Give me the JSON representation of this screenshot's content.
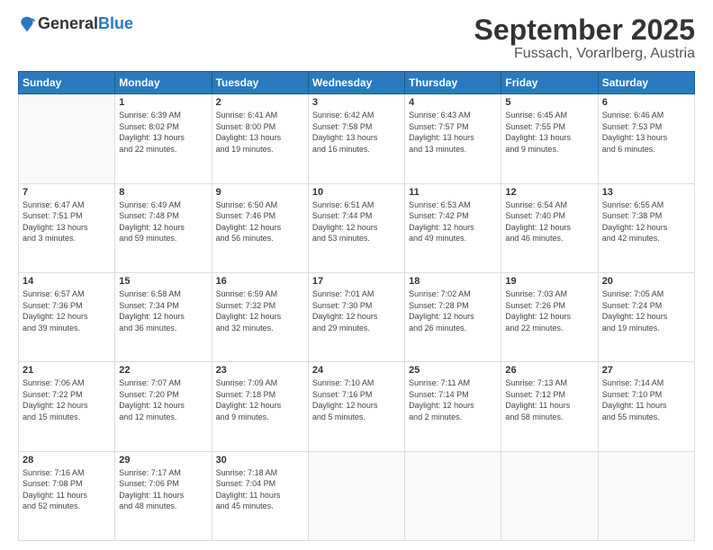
{
  "logo": {
    "general": "General",
    "blue": "Blue"
  },
  "title": "September 2025",
  "location": "Fussach, Vorarlberg, Austria",
  "days_of_week": [
    "Sunday",
    "Monday",
    "Tuesday",
    "Wednesday",
    "Thursday",
    "Friday",
    "Saturday"
  ],
  "weeks": [
    [
      {
        "day": "",
        "info": ""
      },
      {
        "day": "1",
        "info": "Sunrise: 6:39 AM\nSunset: 8:02 PM\nDaylight: 13 hours\nand 22 minutes."
      },
      {
        "day": "2",
        "info": "Sunrise: 6:41 AM\nSunset: 8:00 PM\nDaylight: 13 hours\nand 19 minutes."
      },
      {
        "day": "3",
        "info": "Sunrise: 6:42 AM\nSunset: 7:58 PM\nDaylight: 13 hours\nand 16 minutes."
      },
      {
        "day": "4",
        "info": "Sunrise: 6:43 AM\nSunset: 7:57 PM\nDaylight: 13 hours\nand 13 minutes."
      },
      {
        "day": "5",
        "info": "Sunrise: 6:45 AM\nSunset: 7:55 PM\nDaylight: 13 hours\nand 9 minutes."
      },
      {
        "day": "6",
        "info": "Sunrise: 6:46 AM\nSunset: 7:53 PM\nDaylight: 13 hours\nand 6 minutes."
      }
    ],
    [
      {
        "day": "7",
        "info": "Sunrise: 6:47 AM\nSunset: 7:51 PM\nDaylight: 13 hours\nand 3 minutes."
      },
      {
        "day": "8",
        "info": "Sunrise: 6:49 AM\nSunset: 7:48 PM\nDaylight: 12 hours\nand 59 minutes."
      },
      {
        "day": "9",
        "info": "Sunrise: 6:50 AM\nSunset: 7:46 PM\nDaylight: 12 hours\nand 56 minutes."
      },
      {
        "day": "10",
        "info": "Sunrise: 6:51 AM\nSunset: 7:44 PM\nDaylight: 12 hours\nand 53 minutes."
      },
      {
        "day": "11",
        "info": "Sunrise: 6:53 AM\nSunset: 7:42 PM\nDaylight: 12 hours\nand 49 minutes."
      },
      {
        "day": "12",
        "info": "Sunrise: 6:54 AM\nSunset: 7:40 PM\nDaylight: 12 hours\nand 46 minutes."
      },
      {
        "day": "13",
        "info": "Sunrise: 6:55 AM\nSunset: 7:38 PM\nDaylight: 12 hours\nand 42 minutes."
      }
    ],
    [
      {
        "day": "14",
        "info": "Sunrise: 6:57 AM\nSunset: 7:36 PM\nDaylight: 12 hours\nand 39 minutes."
      },
      {
        "day": "15",
        "info": "Sunrise: 6:58 AM\nSunset: 7:34 PM\nDaylight: 12 hours\nand 36 minutes."
      },
      {
        "day": "16",
        "info": "Sunrise: 6:59 AM\nSunset: 7:32 PM\nDaylight: 12 hours\nand 32 minutes."
      },
      {
        "day": "17",
        "info": "Sunrise: 7:01 AM\nSunset: 7:30 PM\nDaylight: 12 hours\nand 29 minutes."
      },
      {
        "day": "18",
        "info": "Sunrise: 7:02 AM\nSunset: 7:28 PM\nDaylight: 12 hours\nand 26 minutes."
      },
      {
        "day": "19",
        "info": "Sunrise: 7:03 AM\nSunset: 7:26 PM\nDaylight: 12 hours\nand 22 minutes."
      },
      {
        "day": "20",
        "info": "Sunrise: 7:05 AM\nSunset: 7:24 PM\nDaylight: 12 hours\nand 19 minutes."
      }
    ],
    [
      {
        "day": "21",
        "info": "Sunrise: 7:06 AM\nSunset: 7:22 PM\nDaylight: 12 hours\nand 15 minutes."
      },
      {
        "day": "22",
        "info": "Sunrise: 7:07 AM\nSunset: 7:20 PM\nDaylight: 12 hours\nand 12 minutes."
      },
      {
        "day": "23",
        "info": "Sunrise: 7:09 AM\nSunset: 7:18 PM\nDaylight: 12 hours\nand 9 minutes."
      },
      {
        "day": "24",
        "info": "Sunrise: 7:10 AM\nSunset: 7:16 PM\nDaylight: 12 hours\nand 5 minutes."
      },
      {
        "day": "25",
        "info": "Sunrise: 7:11 AM\nSunset: 7:14 PM\nDaylight: 12 hours\nand 2 minutes."
      },
      {
        "day": "26",
        "info": "Sunrise: 7:13 AM\nSunset: 7:12 PM\nDaylight: 11 hours\nand 58 minutes."
      },
      {
        "day": "27",
        "info": "Sunrise: 7:14 AM\nSunset: 7:10 PM\nDaylight: 11 hours\nand 55 minutes."
      }
    ],
    [
      {
        "day": "28",
        "info": "Sunrise: 7:16 AM\nSunset: 7:08 PM\nDaylight: 11 hours\nand 52 minutes."
      },
      {
        "day": "29",
        "info": "Sunrise: 7:17 AM\nSunset: 7:06 PM\nDaylight: 11 hours\nand 48 minutes."
      },
      {
        "day": "30",
        "info": "Sunrise: 7:18 AM\nSunset: 7:04 PM\nDaylight: 11 hours\nand 45 minutes."
      },
      {
        "day": "",
        "info": ""
      },
      {
        "day": "",
        "info": ""
      },
      {
        "day": "",
        "info": ""
      },
      {
        "day": "",
        "info": ""
      }
    ]
  ]
}
